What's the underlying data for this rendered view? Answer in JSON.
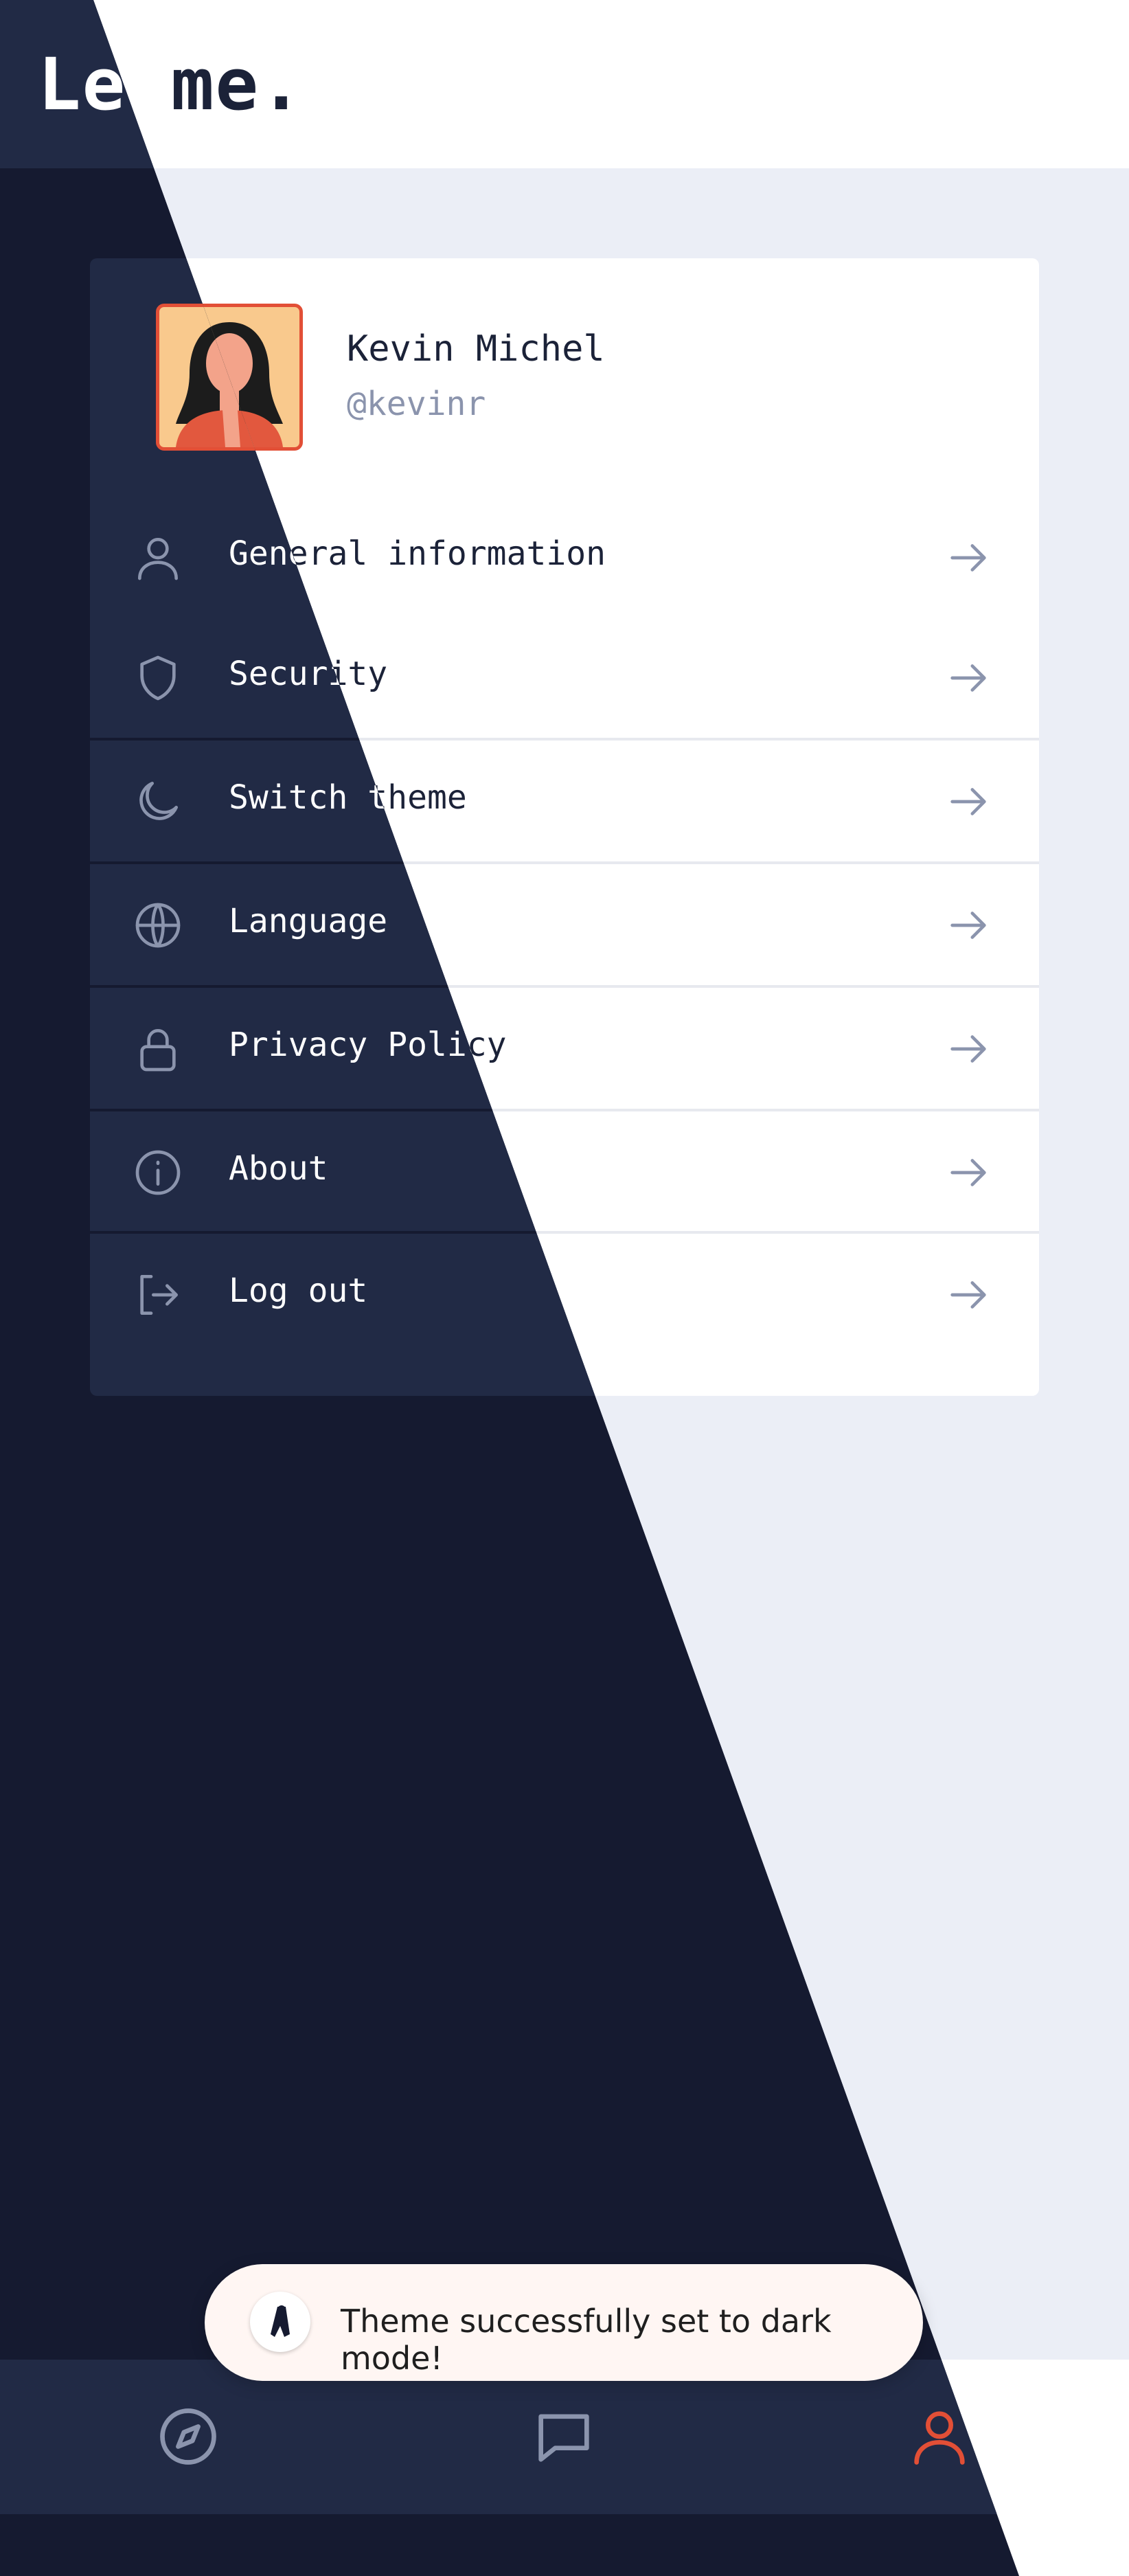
{
  "app": {
    "title": "Le me."
  },
  "profile": {
    "name": "Kevin Michel",
    "handle": "@kevinr"
  },
  "menu": [
    {
      "label": "General information",
      "icon": "user-icon"
    },
    {
      "label": "Security",
      "icon": "shield-icon"
    },
    {
      "label": "Switch theme",
      "icon": "moon-icon"
    },
    {
      "label": "Language",
      "icon": "globe-icon"
    },
    {
      "label": "Privacy Policy",
      "icon": "lock-icon"
    },
    {
      "label": "About",
      "icon": "info-icon"
    },
    {
      "label": "Log out",
      "icon": "logout-icon"
    }
  ],
  "bottom_nav": [
    {
      "icon": "compass-icon",
      "active": false
    },
    {
      "icon": "chat-icon",
      "active": false
    },
    {
      "icon": "profile-icon",
      "active": true
    }
  ],
  "toast": {
    "message": "Theme successfully set to dark mode!"
  },
  "colors": {
    "accent": "#e24f36",
    "light_bg": "#ebeef6",
    "dark_bg": "#151a30",
    "dark_surface": "#212a45",
    "muted_icon": "#8b94ad"
  }
}
